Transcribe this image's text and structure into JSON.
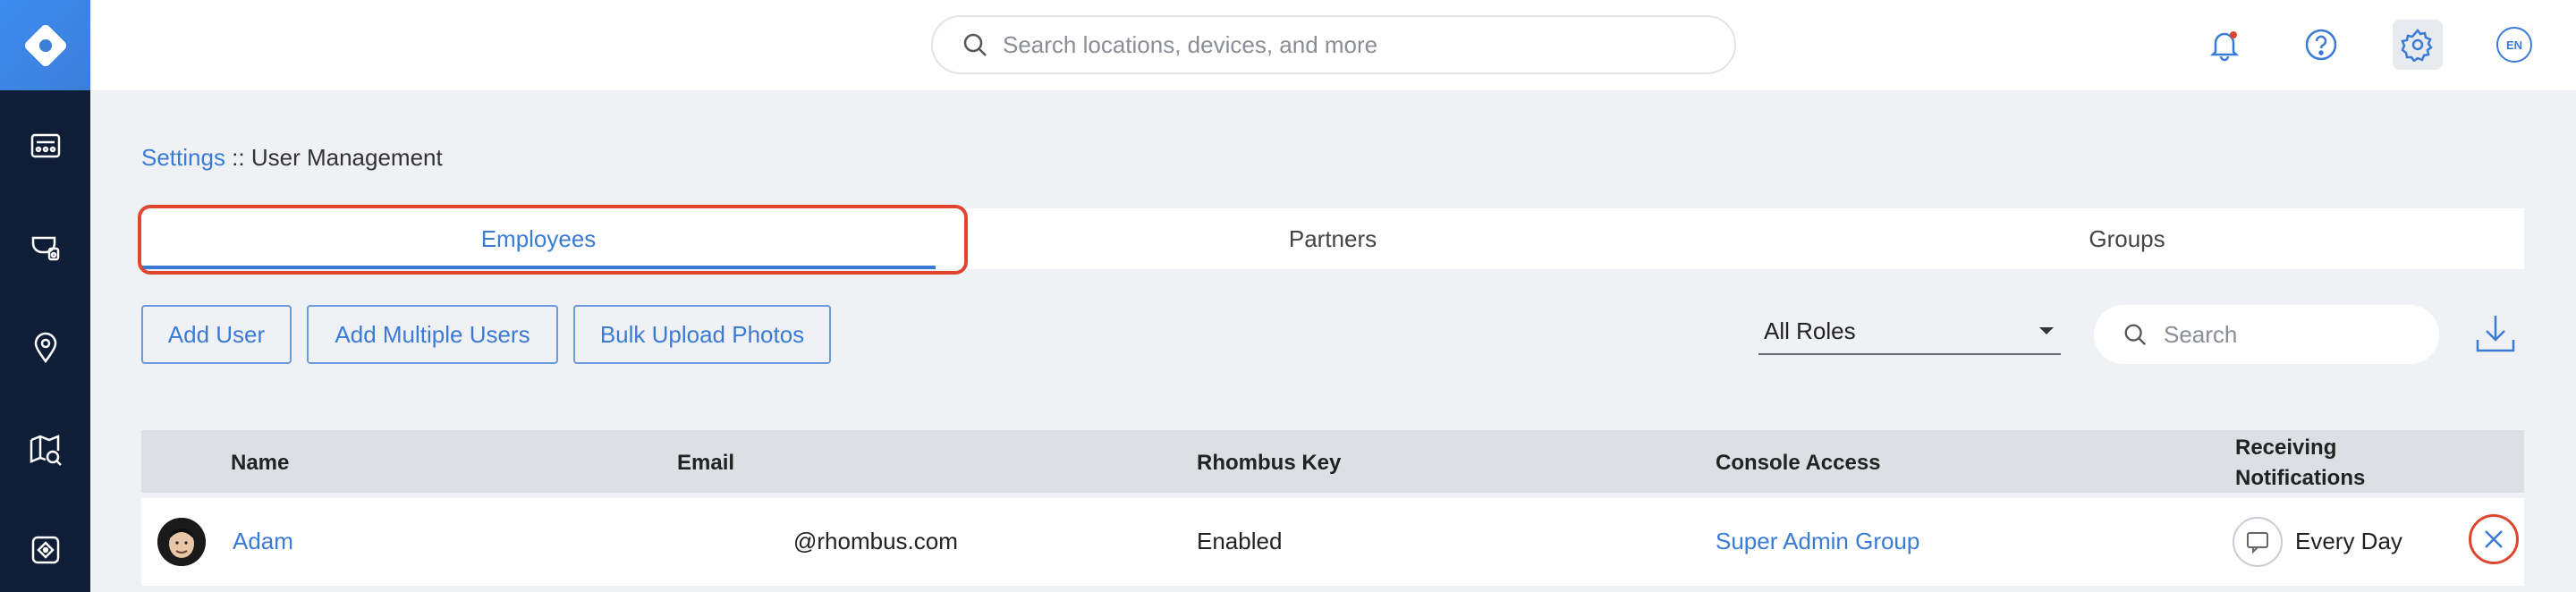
{
  "colors": {
    "accent": "#3a7bd5",
    "highlight": "#e0462f",
    "sidebar": "#0f1d36",
    "notification_dot": "#e0462f"
  },
  "sidebar": {
    "logo_icon": "rhombus-logo-icon",
    "items": [
      {
        "icon": "dashboard-icon"
      },
      {
        "icon": "camera-icon"
      },
      {
        "icon": "location-pin-icon"
      },
      {
        "icon": "map-search-icon"
      },
      {
        "icon": "device-icon"
      }
    ]
  },
  "topbar": {
    "search_placeholder": "Search locations, devices, and more",
    "icons": [
      "bell-icon",
      "help-icon",
      "gear-icon"
    ],
    "language": "EN"
  },
  "breadcrumb": {
    "parent": "Settings",
    "separator": " :: ",
    "current": "User Management"
  },
  "tabs": [
    {
      "label": "Employees",
      "active": true
    },
    {
      "label": "Partners",
      "active": false
    },
    {
      "label": "Groups",
      "active": false
    }
  ],
  "actions": {
    "add_user": "Add User",
    "add_multiple": "Add Multiple Users",
    "bulk_upload": "Bulk Upload Photos",
    "roles_filter": "All Roles",
    "search_placeholder": "Search"
  },
  "table": {
    "headers": {
      "name": "Name",
      "email": "Email",
      "key": "Rhombus Key",
      "console": "Console Access",
      "notifications_line1": "Receiving",
      "notifications_line2": "Notifications"
    },
    "rows": [
      {
        "name": "Adam",
        "email": "@rhombus.com",
        "key": "Enabled",
        "console": "Super Admin Group",
        "notifications": "Every Day"
      }
    ]
  }
}
